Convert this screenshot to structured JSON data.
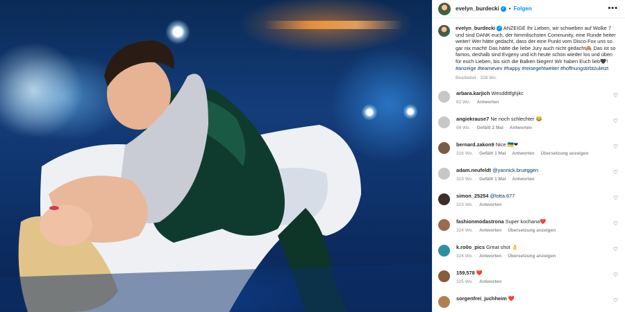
{
  "post": {
    "username": "evelyn_burdecki",
    "verified_mark": "✓",
    "follow_label": "Folgen",
    "separator": "•",
    "more_label": "•••"
  },
  "caption": {
    "username": "evelyn_burdecki",
    "text_part1": " ANZEIGE Ihr Lieben, wir schweben auf Wolke 7 und sind DANK euch, der himmlischsten Community, eine Runde heiter weiter! Wer hätte gedacht, dass der eine Punkt vom Disco-Fox uns so gar nix macht! Das hätte die liebe Jury auch nicht gedacht",
    "emoji1": "🙈",
    "text_part2": " Das ist so famos, deshalb sind Evgeny und ich heute schon wieder los und üben für euch Lieben, bis sich die Balken biegen! Wir haben Euch lieb",
    "emoji2": "🖤",
    "text_part3": "! ",
    "hashtags": "#anzeige #teamevev #happy #reisegehtweiter #hoffnungstirbtzuletzt",
    "meta": "Bearbeitet · 328 Wo."
  },
  "comments": [
    {
      "user": "arbara.karjich",
      "text": "Wesddttfghjkc",
      "time": "82 Wo.",
      "likes": "",
      "reply": "Antworten",
      "translate": "",
      "avatar_color": "#c7c7c7"
    },
    {
      "user": "angiekrause7",
      "text": "Ne noch schlechter 😂",
      "time": "98 Wo.",
      "likes": "Gefällt 2 Mal",
      "reply": "Antworten",
      "translate": "",
      "avatar_color": "#c7c7c7"
    },
    {
      "user": "bernard.zakon9",
      "text": "Nice 🇺🇦❤",
      "time": "316 Wo.",
      "likes": "Gefällt 1 Mal",
      "reply": "Antworten",
      "translate": "Übersetzung anzeigen",
      "avatar_color": "#7a5c45"
    },
    {
      "user": "adam.neufeldt",
      "text": "",
      "mention": "@yannick.brueggen",
      "time": "323 Wo.",
      "likes": "Gefällt 1 Mal",
      "reply": "Antworten",
      "translate": "",
      "avatar_color": "#c7c7c7"
    },
    {
      "user": "simon_25254",
      "text": "",
      "mention": "@lotta.677",
      "time": "323 Wo.",
      "likes": "",
      "reply": "Antworten",
      "translate": "",
      "avatar_color": "#3a2f2a"
    },
    {
      "user": "fashionmodastrona",
      "text": "Super kochana❤️",
      "time": "324 Wo.",
      "likes": "",
      "reply": "Antworten",
      "translate": "Übersetzung anzeigen",
      "avatar_color": "#9b6b4d"
    },
    {
      "user": "k.ro0o_pics",
      "text": "Great shot 👌",
      "time": "324 Wo.",
      "likes": "",
      "reply": "Antworten",
      "translate": "Übersetzung anzeigen",
      "avatar_color": "#2f8fa0"
    },
    {
      "user": "159.578",
      "text": "❤️",
      "time": "325 Wo.",
      "likes": "",
      "reply": "Antworten",
      "translate": "",
      "avatar_color": "#8a5a3c"
    },
    {
      "user": "sorgenfrei_juchheim",
      "text": "❤️",
      "time": "",
      "likes": "",
      "reply": "",
      "translate": "",
      "avatar_color": "#b08050"
    }
  ],
  "icons": {
    "like": "heart-icon",
    "more": "more-options-icon",
    "verified": "verified-badge-icon"
  },
  "colors": {
    "link": "#0095f6",
    "hashtag": "#00376b",
    "muted": "#8e8e8e"
  }
}
